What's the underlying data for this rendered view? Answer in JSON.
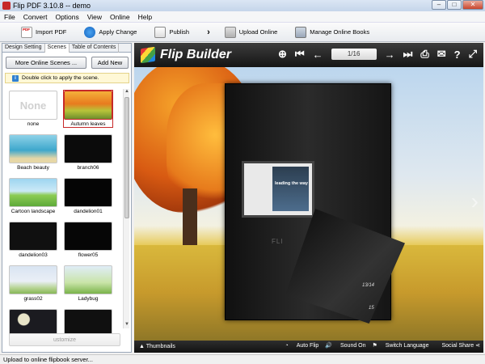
{
  "window": {
    "title": "Flip PDF 3.10.8  -- demo"
  },
  "menu": [
    "File",
    "Convert",
    "Options",
    "View",
    "Online",
    "Help"
  ],
  "toolbar": {
    "import_pdf": "Import PDF",
    "apply_change": "Apply Change",
    "publish": "Publish",
    "upload_online": "Upload Online",
    "manage_online_books": "Manage Online Books"
  },
  "tabs": [
    "Design Setting",
    "Scenes",
    "Table of Contents"
  ],
  "scenes_panel": {
    "more_button": "More Online Scenes ...",
    "add_button": "Add New",
    "hint": "Double click to apply the scene.",
    "none_thumb_text": "None",
    "customize_button": "ustomize",
    "items": [
      "none",
      "Autumn leaves",
      "Beach beauty",
      "branch06",
      "Cartoon landscape",
      "dandelion01",
      "dandelion03",
      "flower05",
      "grass02",
      "Ladybug"
    ]
  },
  "viewer": {
    "brand": "Flip Builder",
    "page_indicator": "1/16",
    "book_screen_text": "leading the way",
    "book_label": "FLI",
    "curl_numbers": [
      "13/14",
      "15"
    ],
    "bottom": {
      "thumbnails": "Thumbnails",
      "auto_flip": "Auto Flip",
      "sound_on": "Sound On",
      "switch_language": "Switch Language",
      "social_share": "Social Share"
    }
  },
  "status": "Upload to online flipbook server..."
}
